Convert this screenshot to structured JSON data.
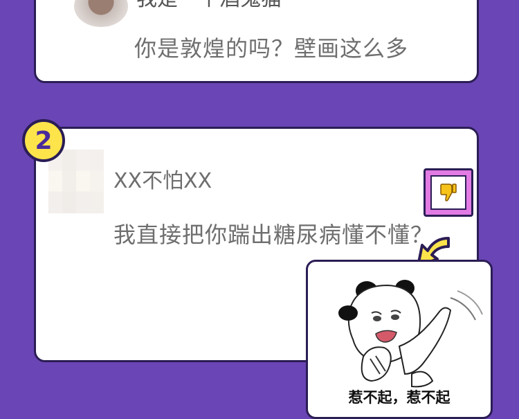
{
  "posts": [
    {
      "username": "我是一个酒鬼猫",
      "comment": "你是敦煌的吗？壁画这么多"
    },
    {
      "rank": "2",
      "username": "XX不怕XX",
      "comment": "我直接把你踹出糖尿病懂不懂？"
    }
  ],
  "meme": {
    "caption": "惹不起，惹不起"
  },
  "colors": {
    "background": "#6a45b5",
    "badge": "#fde44b",
    "dislike_frame": "#e27be4",
    "arrow": "#fde44b",
    "outline": "#2b1d55"
  },
  "icons": [
    "thumbs-down-icon",
    "arrow-icon",
    "panda-meme"
  ]
}
